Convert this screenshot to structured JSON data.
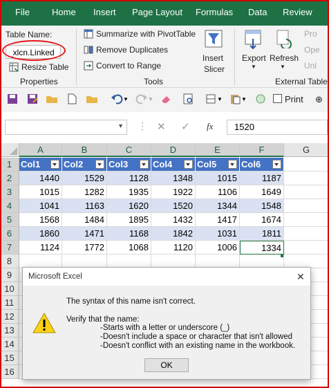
{
  "ribbon_tabs": [
    "File",
    "Home",
    "Insert",
    "Page Layout",
    "Formulas",
    "Data",
    "Review"
  ],
  "properties": {
    "table_name_label": "Table Name:",
    "table_name_value": "_xlcn.Linked",
    "resize_label": "Resize Table",
    "group_label": "Properties"
  },
  "tools": {
    "summarize": "Summarize with PivotTable",
    "remove_dup": "Remove Duplicates",
    "convert": "Convert to Range",
    "insert_slicer_1": "Insert",
    "insert_slicer_2": "Slicer",
    "group_label": "Tools"
  },
  "external": {
    "export": "Export",
    "refresh": "Refresh",
    "prop": "Pro",
    "open": "Ope",
    "unlink": "Unl",
    "group_label": "External Table D"
  },
  "qat": {
    "print_label": "Print"
  },
  "formula_bar": {
    "fx": "fx",
    "value": "1520"
  },
  "columns": [
    "A",
    "B",
    "C",
    "D",
    "E",
    "F",
    "G"
  ],
  "rows": [
    "1",
    "2",
    "3",
    "4",
    "5",
    "6",
    "7",
    "8",
    "9",
    "10",
    "11",
    "12",
    "13",
    "14",
    "15",
    "16"
  ],
  "table": {
    "headers": [
      "Col1",
      "Col2",
      "Col3",
      "Col4",
      "Col5",
      "Col6"
    ],
    "data": [
      [
        "1440",
        "1529",
        "1128",
        "1348",
        "1015",
        "1187"
      ],
      [
        "1015",
        "1282",
        "1935",
        "1922",
        "1106",
        "1649"
      ],
      [
        "1041",
        "1163",
        "1620",
        "1520",
        "1344",
        "1548"
      ],
      [
        "1568",
        "1484",
        "1895",
        "1432",
        "1417",
        "1674"
      ],
      [
        "1860",
        "1471",
        "1168",
        "1842",
        "1031",
        "1811"
      ],
      [
        "1124",
        "1772",
        "1068",
        "1120",
        "1006",
        "1334"
      ]
    ]
  },
  "dialog": {
    "title": "Microsoft Excel",
    "message": "The syntax of this name isn't correct.",
    "verify": "Verify that the name:",
    "rule1": "-Starts with a letter or underscore (_)",
    "rule2": "-Doesn't include a space or character that isn't allowed",
    "rule3": "-Doesn't conflict with an existing name in the workbook.",
    "ok": "OK",
    "close_symbol": "✕",
    "warning_symbol": "!"
  },
  "colors": {
    "excel_green": "#1e7145",
    "table_header": "#4472c4",
    "band": "#d9e1f2",
    "annotation": "#e2181b"
  }
}
